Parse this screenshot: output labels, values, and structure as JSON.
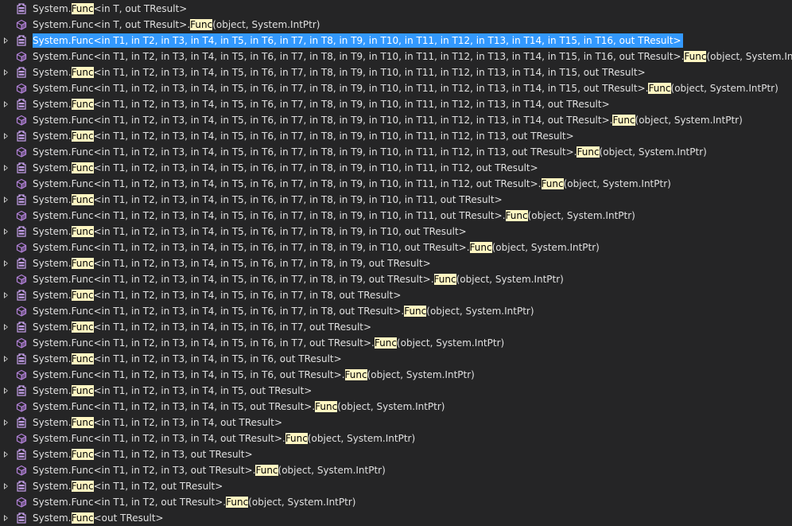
{
  "highlight": "Func",
  "rows": [
    {
      "kind": "class",
      "expandable": false,
      "segments": [
        "System.",
        "#Func",
        "<in T, out TResult>"
      ]
    },
    {
      "kind": "method",
      "expandable": false,
      "segments": [
        "System.Func<in T, out TResult>.",
        "#Func",
        "(object, System.IntPtr)"
      ]
    },
    {
      "kind": "class",
      "expandable": true,
      "selected": true,
      "segments": [
        "System.Func<in T1, in T2, in T3, in T4, in T5, in T6, in T7, in T8, in T9, in T10, in T11, in T12, in T13, in T14, in T15, in T16, out TResult>"
      ]
    },
    {
      "kind": "method",
      "expandable": false,
      "segments": [
        "System.Func<in T1, in T2, in T3, in T4, in T5, in T6, in T7, in T8, in T9, in T10, in T11, in T12, in T13, in T14, in T15, in T16, out TResult>.",
        "#Func",
        "(object, System.IntPtr)"
      ]
    },
    {
      "kind": "class",
      "expandable": true,
      "segments": [
        "System.",
        "#Func",
        "<in T1, in T2, in T3, in T4, in T5, in T6, in T7, in T8, in T9, in T10, in T11, in T12, in T13, in T14, in T15, out TResult>"
      ]
    },
    {
      "kind": "method",
      "expandable": false,
      "segments": [
        "System.Func<in T1, in T2, in T3, in T4, in T5, in T6, in T7, in T8, in T9, in T10, in T11, in T12, in T13, in T14, in T15, out TResult>.",
        "#Func",
        "(object, System.IntPtr)"
      ]
    },
    {
      "kind": "class",
      "expandable": true,
      "segments": [
        "System.",
        "#Func",
        "<in T1, in T2, in T3, in T4, in T5, in T6, in T7, in T8, in T9, in T10, in T11, in T12, in T13, in T14, out TResult>"
      ]
    },
    {
      "kind": "method",
      "expandable": false,
      "segments": [
        "System.Func<in T1, in T2, in T3, in T4, in T5, in T6, in T7, in T8, in T9, in T10, in T11, in T12, in T13, in T14, out TResult>.",
        "#Func",
        "(object, System.IntPtr)"
      ]
    },
    {
      "kind": "class",
      "expandable": true,
      "segments": [
        "System.",
        "#Func",
        "<in T1, in T2, in T3, in T4, in T5, in T6, in T7, in T8, in T9, in T10, in T11, in T12, in T13, out TResult>"
      ]
    },
    {
      "kind": "method",
      "expandable": false,
      "segments": [
        "System.Func<in T1, in T2, in T3, in T4, in T5, in T6, in T7, in T8, in T9, in T10, in T11, in T12, in T13, out TResult>.",
        "#Func",
        "(object, System.IntPtr)"
      ]
    },
    {
      "kind": "class",
      "expandable": true,
      "segments": [
        "System.",
        "#Func",
        "<in T1, in T2, in T3, in T4, in T5, in T6, in T7, in T8, in T9, in T10, in T11, in T12, out TResult>"
      ]
    },
    {
      "kind": "method",
      "expandable": false,
      "segments": [
        "System.Func<in T1, in T2, in T3, in T4, in T5, in T6, in T7, in T8, in T9, in T10, in T11, in T12, out TResult>.",
        "#Func",
        "(object, System.IntPtr)"
      ]
    },
    {
      "kind": "class",
      "expandable": true,
      "segments": [
        "System.",
        "#Func",
        "<in T1, in T2, in T3, in T4, in T5, in T6, in T7, in T8, in T9, in T10, in T11, out TResult>"
      ]
    },
    {
      "kind": "method",
      "expandable": false,
      "segments": [
        "System.Func<in T1, in T2, in T3, in T4, in T5, in T6, in T7, in T8, in T9, in T10, in T11, out TResult>.",
        "#Func",
        "(object, System.IntPtr)"
      ]
    },
    {
      "kind": "class",
      "expandable": true,
      "segments": [
        "System.",
        "#Func",
        "<in T1, in T2, in T3, in T4, in T5, in T6, in T7, in T8, in T9, in T10, out TResult>"
      ]
    },
    {
      "kind": "method",
      "expandable": false,
      "segments": [
        "System.Func<in T1, in T2, in T3, in T4, in T5, in T6, in T7, in T8, in T9, in T10, out TResult>.",
        "#Func",
        "(object, System.IntPtr)"
      ]
    },
    {
      "kind": "class",
      "expandable": true,
      "segments": [
        "System.",
        "#Func",
        "<in T1, in T2, in T3, in T4, in T5, in T6, in T7, in T8, in T9, out TResult>"
      ]
    },
    {
      "kind": "method",
      "expandable": false,
      "segments": [
        "System.Func<in T1, in T2, in T3, in T4, in T5, in T6, in T7, in T8, in T9, out TResult>.",
        "#Func",
        "(object, System.IntPtr)"
      ]
    },
    {
      "kind": "class",
      "expandable": true,
      "segments": [
        "System.",
        "#Func",
        "<in T1, in T2, in T3, in T4, in T5, in T6, in T7, in T8, out TResult>"
      ]
    },
    {
      "kind": "method",
      "expandable": false,
      "segments": [
        "System.Func<in T1, in T2, in T3, in T4, in T5, in T6, in T7, in T8, out TResult>.",
        "#Func",
        "(object, System.IntPtr)"
      ]
    },
    {
      "kind": "class",
      "expandable": true,
      "segments": [
        "System.",
        "#Func",
        "<in T1, in T2, in T3, in T4, in T5, in T6, in T7, out TResult>"
      ]
    },
    {
      "kind": "method",
      "expandable": false,
      "segments": [
        "System.Func<in T1, in T2, in T3, in T4, in T5, in T6, in T7, out TResult>.",
        "#Func",
        "(object, System.IntPtr)"
      ]
    },
    {
      "kind": "class",
      "expandable": true,
      "segments": [
        "System.",
        "#Func",
        "<in T1, in T2, in T3, in T4, in T5, in T6, out TResult>"
      ]
    },
    {
      "kind": "method",
      "expandable": false,
      "segments": [
        "System.Func<in T1, in T2, in T3, in T4, in T5, in T6, out TResult>.",
        "#Func",
        "(object, System.IntPtr)"
      ]
    },
    {
      "kind": "class",
      "expandable": true,
      "segments": [
        "System.",
        "#Func",
        "<in T1, in T2, in T3, in T4, in T5, out TResult>"
      ]
    },
    {
      "kind": "method",
      "expandable": false,
      "segments": [
        "System.Func<in T1, in T2, in T3, in T4, in T5, out TResult>.",
        "#Func",
        "(object, System.IntPtr)"
      ]
    },
    {
      "kind": "class",
      "expandable": true,
      "segments": [
        "System.",
        "#Func",
        "<in T1, in T2, in T3, in T4, out TResult>"
      ]
    },
    {
      "kind": "method",
      "expandable": false,
      "segments": [
        "System.Func<in T1, in T2, in T3, in T4, out TResult>.",
        "#Func",
        "(object, System.IntPtr)"
      ]
    },
    {
      "kind": "class",
      "expandable": true,
      "segments": [
        "System.",
        "#Func",
        "<in T1, in T2, in T3, out TResult>"
      ]
    },
    {
      "kind": "method",
      "expandable": false,
      "segments": [
        "System.Func<in T1, in T2, in T3, out TResult>.",
        "#Func",
        "(object, System.IntPtr)"
      ]
    },
    {
      "kind": "class",
      "expandable": true,
      "segments": [
        "System.",
        "#Func",
        "<in T1, in T2, out TResult>"
      ]
    },
    {
      "kind": "method",
      "expandable": false,
      "segments": [
        "System.Func<in T1, in T2, out TResult>.",
        "#Func",
        "(object, System.IntPtr)"
      ]
    },
    {
      "kind": "class",
      "expandable": true,
      "segments": [
        "System.",
        "#Func",
        "<out TResult>"
      ]
    }
  ],
  "colors": {
    "background": "#252526",
    "text": "#e0e0e0",
    "match_highlight_bg": "#fff6c2",
    "selection_bg": "#3399ff",
    "class_icon": "#c39ee8",
    "method_icon": "#b180d7"
  },
  "icons": {
    "class": "delegate-class-icon",
    "method": "method-cube-icon",
    "expander": "expand-triangle-icon"
  }
}
